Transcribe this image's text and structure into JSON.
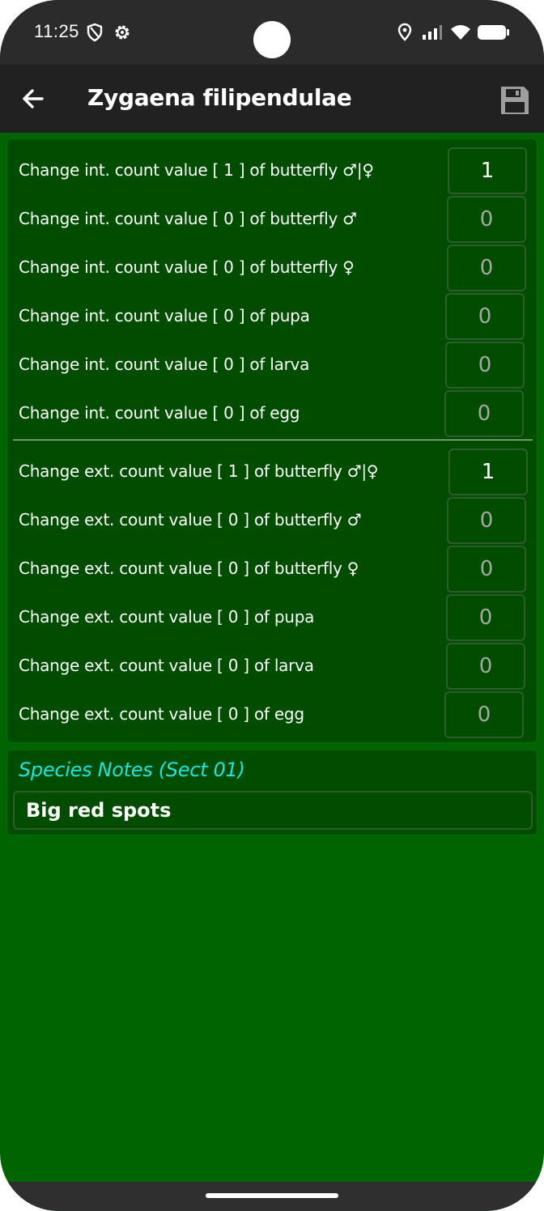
{
  "status": {
    "time": "11:25",
    "icons": [
      "shield-icon",
      "gear-icon",
      "location-icon",
      "signal-icon",
      "wifi-icon",
      "battery-icon"
    ]
  },
  "appbar": {
    "title": "Zygaena filipendulae",
    "back_icon": "arrow-left-icon",
    "save_icon": "floppy-disk-icon"
  },
  "internal_counts": [
    {
      "label": "Change int. count value [ 1 ] of butterfly ♂|♀",
      "value": "1"
    },
    {
      "label": "Change int. count value [ 0 ] of butterfly ♂",
      "value": "0"
    },
    {
      "label": "Change int. count value [ 0 ] of butterfly ♀",
      "value": "0"
    },
    {
      "label": "Change int. count value [ 0 ] of pupa",
      "value": "0"
    },
    {
      "label": "Change int. count value [ 0 ] of larva",
      "value": "0"
    },
    {
      "label": "Change int. count value [ 0 ] of egg",
      "value": "0"
    }
  ],
  "external_counts": [
    {
      "label": "Change ext. count value [ 1 ] of butterfly ♂|♀",
      "value": "1"
    },
    {
      "label": "Change ext. count value [ 0 ] of butterfly ♂",
      "value": "0"
    },
    {
      "label": "Change ext. count value [ 0 ] of butterfly ♀",
      "value": "0"
    },
    {
      "label": "Change ext. count value [ 0 ] of pupa",
      "value": "0"
    },
    {
      "label": "Change ext. count value [ 0 ] of larva",
      "value": "0"
    },
    {
      "label": "Change ext. count value [ 0 ] of egg",
      "value": "0"
    }
  ],
  "notes": {
    "title": "Species Notes (Sect 01)",
    "value": "Big red spots"
  },
  "colors": {
    "background": "#006400",
    "panel": "#004d00",
    "appbar": "#212121",
    "notes_title": "#1ee3e3",
    "placeholder_text": "#a6a6a6"
  }
}
